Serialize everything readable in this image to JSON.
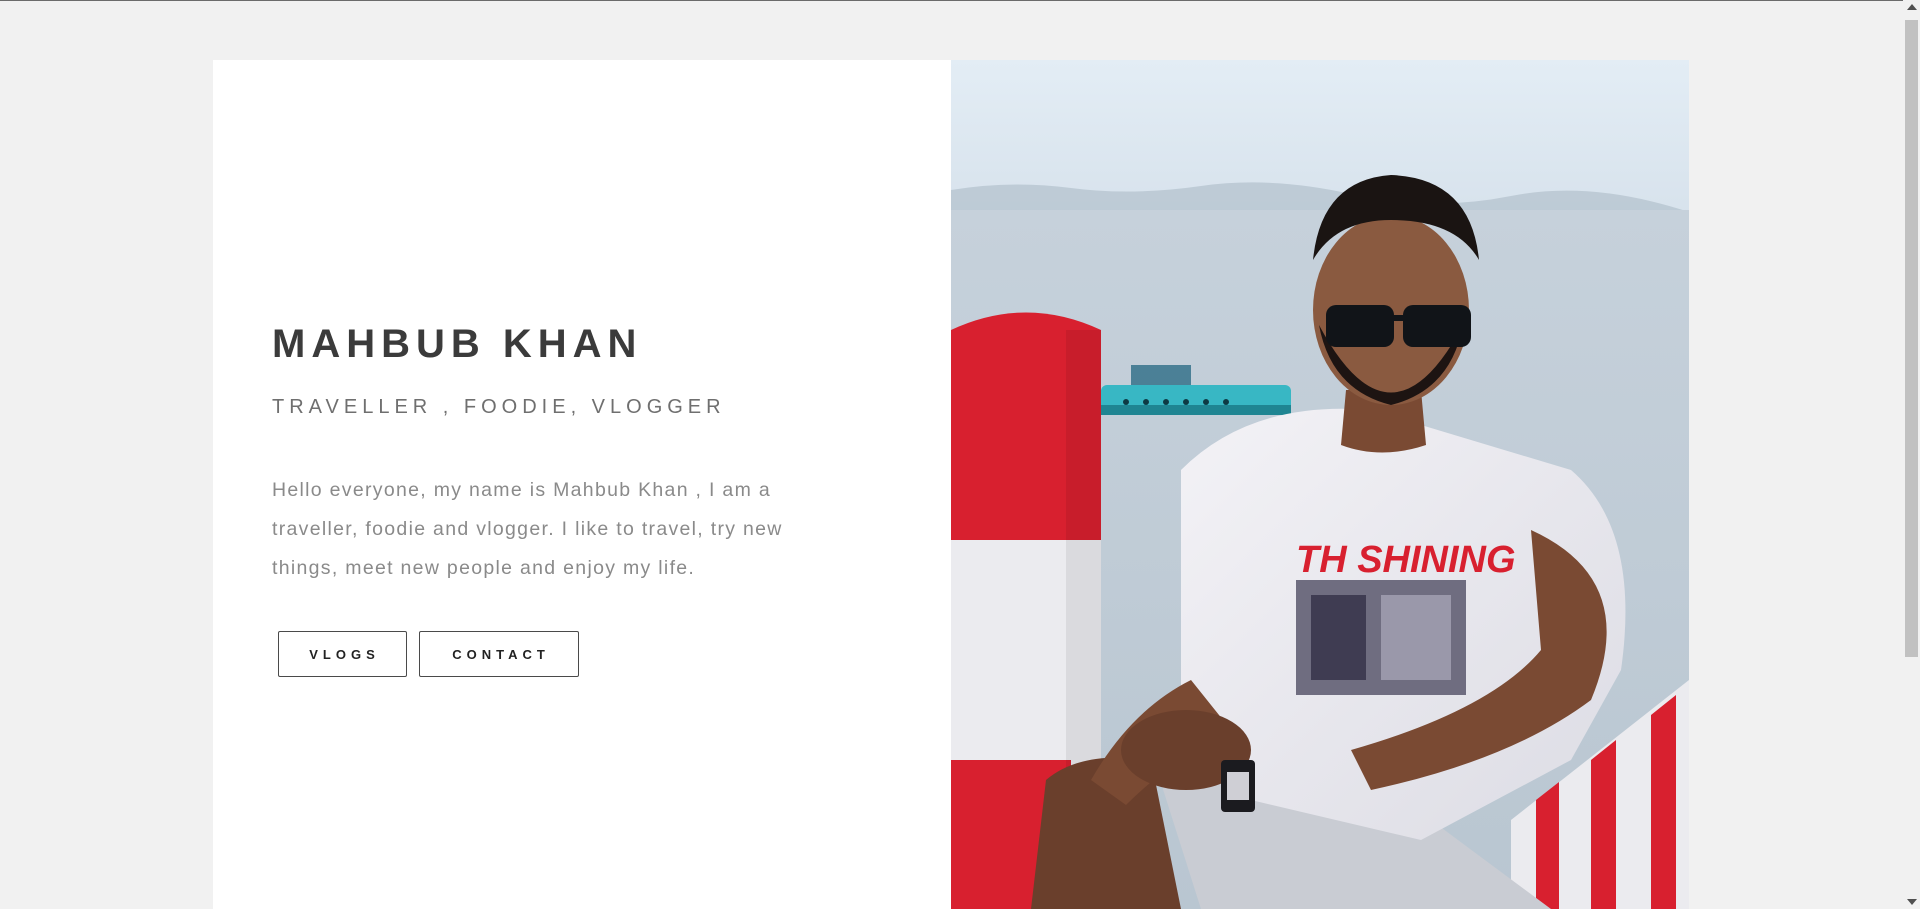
{
  "profile": {
    "name": "MAHBUB KHAN",
    "tagline": "TRAVELLER , FOODIE, VLOGGER",
    "bio": "Hello everyone, my name is Mahbub Khan , I am a traveller, foodie and vlogger. I like to travel, try new things, meet new people and enjoy my life."
  },
  "buttons": {
    "vlogs": "VLOGS",
    "contact": "CONTACT"
  },
  "photo": {
    "shirt_text": "TH SHINING"
  },
  "colors": {
    "page_background": "#f1f1f1",
    "card_background": "#ffffff",
    "heading": "#3b3b3b",
    "subheading": "#6f6f6f",
    "body_text": "#8a8a8a",
    "button_border": "#4a4a4a",
    "accent_red": "#d8202f"
  },
  "icons": {
    "scroll_up": "triangle-up-icon",
    "scroll_down": "triangle-down-icon"
  }
}
